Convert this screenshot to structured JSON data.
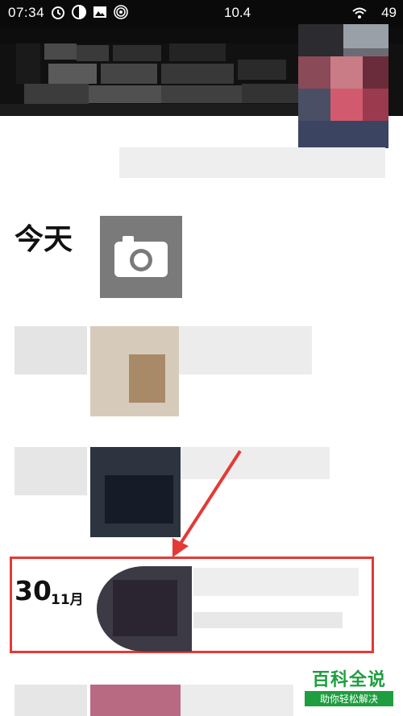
{
  "status_bar": {
    "time": "07:34",
    "network_speed": "10.4",
    "battery": "49",
    "icons": [
      "alarm-icon",
      "half-circle-icon",
      "image-icon",
      "hotspot-icon"
    ]
  },
  "moments": {
    "today_label": "今天",
    "camera_icon": "camera-icon",
    "entry_date": {
      "day": "30",
      "month": "11月"
    }
  },
  "watermark": {
    "title": "百科全说",
    "subtitle": "助你轻松解决"
  },
  "colors": {
    "highlight": "#e53935",
    "camera_bg": "#7a7a7a",
    "watermark_green": "#1e9e3e"
  }
}
